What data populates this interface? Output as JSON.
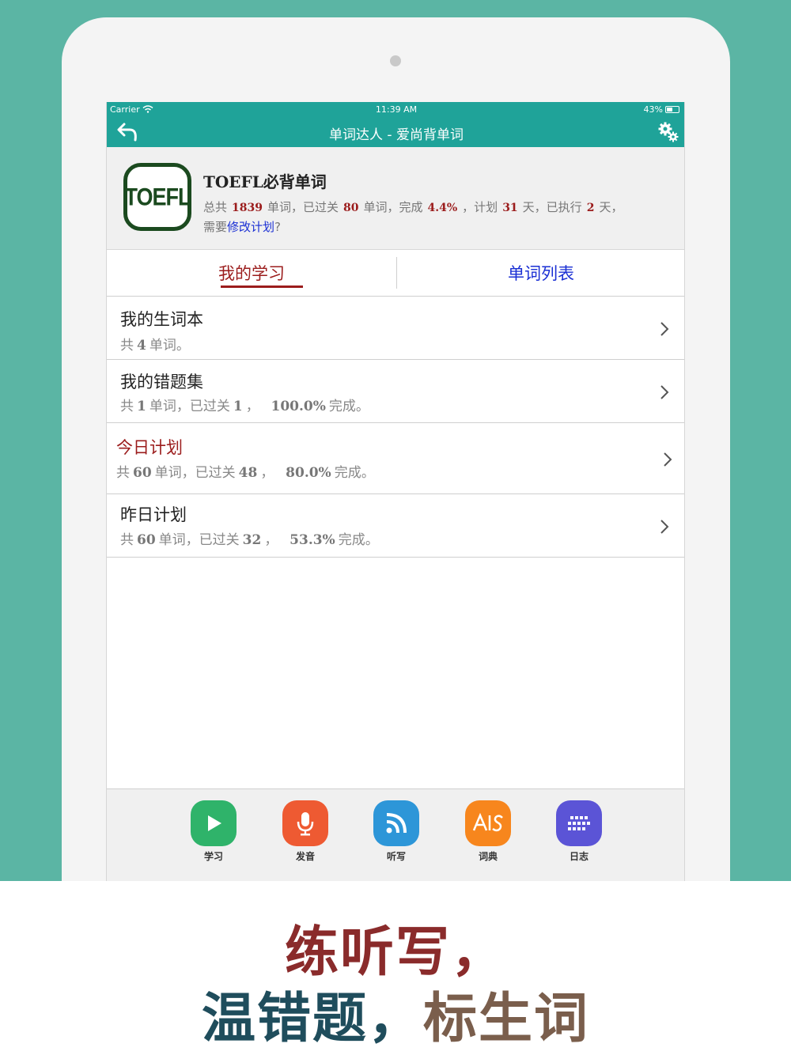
{
  "status_bar": {
    "carrier": "Carrier",
    "time": "11:39 AM",
    "battery": "43%"
  },
  "navbar": {
    "title": "单词达人 - 爱尚背单词",
    "back_icon": "back-arrow-icon",
    "settings_icon": "gears-icon"
  },
  "book": {
    "logo_text": "TOEFL",
    "title": "TOEFL必背单词",
    "stats": {
      "p1": "总共",
      "total": "1839",
      "p2": "单词，已过关",
      "passed": "80",
      "p3": "单词，完成",
      "percent": "4.4%",
      "p4": "，计划",
      "plan_days": "31",
      "p5": "天，已执行",
      "done_days": "2",
      "p6": "天，",
      "p7": "需要",
      "edit_link": "修改计划",
      "p8": "?"
    }
  },
  "tabs": {
    "left": "我的学习",
    "right": "单词列表"
  },
  "rows": [
    {
      "title": "我的生词本",
      "s1": "共",
      "total": "4",
      "s2": "单词。"
    },
    {
      "title": "我的错题集",
      "s1": "共",
      "total": "1",
      "s2": "单词，已过关",
      "passed": "1",
      "s3": "，",
      "percent": "100.0%",
      "s4": "完成。"
    },
    {
      "title": "今日计划",
      "s1": "共",
      "total": "60",
      "s2": "单词，已过关",
      "passed": "48",
      "s3": "，",
      "percent": "80.0%",
      "s4": "完成。"
    },
    {
      "title": "昨日计划",
      "s1": "共",
      "total": "60",
      "s2": "单词，已过关",
      "passed": "32",
      "s3": "，",
      "percent": "53.3%",
      "s4": "完成。"
    }
  ],
  "tabbar": [
    {
      "label": "学习",
      "icon": "play-icon",
      "color": "#2fb36a"
    },
    {
      "label": "发音",
      "icon": "microphone-icon",
      "color": "#ee5a32"
    },
    {
      "label": "听写",
      "icon": "rss-icon",
      "color": "#2d96d8"
    },
    {
      "label": "词典",
      "icon": "dictionary-icon",
      "color": "#f7861d"
    },
    {
      "label": "日志",
      "icon": "calendar-grid-icon",
      "color": "#5b54d6"
    }
  ],
  "caption": {
    "line1": "练听写，",
    "line2a": "温错题，",
    "line2b": "标生词"
  },
  "colors": {
    "teal": "#1fa399",
    "accent_red": "#9b1c1c",
    "link_blue": "#1a2fd4",
    "background": "#5bb5a4"
  }
}
